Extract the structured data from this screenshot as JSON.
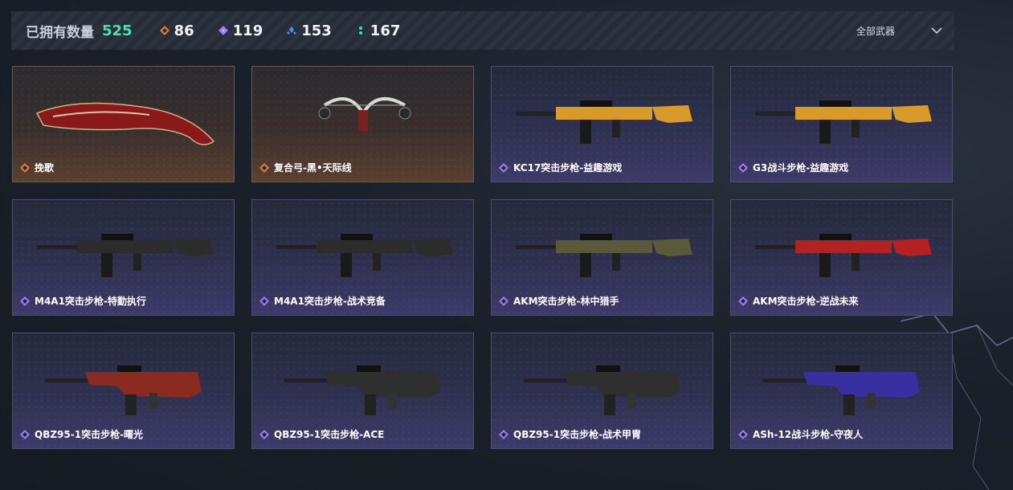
{
  "header": {
    "owned_label": "已拥有数量",
    "owned_total": "525",
    "stats": [
      {
        "icon": "orange-diamond-icon",
        "color": "#e0783a",
        "value": "86"
      },
      {
        "icon": "purple-diamond-icon",
        "color": "#9a7cf2",
        "value": "119"
      },
      {
        "icon": "blue-diamond-icon",
        "color": "#4a8ef0",
        "value": "153"
      },
      {
        "icon": "green-dot-icon",
        "color": "#3fe0b0",
        "value": "167"
      }
    ],
    "filter_label": "全部武器"
  },
  "colors": {
    "accent_green": "#3fe6b0",
    "legendary_orange": "#e0783a",
    "epic_purple": "#9a7cf2"
  },
  "weapons": [
    {
      "name": "挽歌",
      "rarity": "orange",
      "icon": "kukri-icon"
    },
    {
      "name": "复合弓-黑•天际线",
      "rarity": "orange",
      "icon": "compound-bow-icon"
    },
    {
      "name": "KC17突击步枪-益趣游戏",
      "rarity": "purple",
      "icon": "assault-rifle-icon"
    },
    {
      "name": "G3战斗步枪-益趣游戏",
      "rarity": "purple",
      "icon": "battle-rifle-icon"
    },
    {
      "name": "M4A1突击步枪-特勤执行",
      "rarity": "purple",
      "icon": "assault-rifle-icon"
    },
    {
      "name": "M4A1突击步枪-战术竞备",
      "rarity": "purple",
      "icon": "assault-rifle-icon"
    },
    {
      "name": "AKM突击步枪-林中猎手",
      "rarity": "purple",
      "icon": "assault-rifle-icon"
    },
    {
      "name": "AKM突击步枪-逆战未来",
      "rarity": "purple",
      "icon": "assault-rifle-icon"
    },
    {
      "name": "QBZ95-1突击步枪-曙光",
      "rarity": "purple",
      "icon": "bullpup-rifle-icon"
    },
    {
      "name": "QBZ95-1突击步枪-ACE",
      "rarity": "purple",
      "icon": "bullpup-rifle-icon"
    },
    {
      "name": "QBZ95-1突击步枪-战术甲胄",
      "rarity": "purple",
      "icon": "bullpup-rifle-icon"
    },
    {
      "name": "ASh-12战斗步枪-守夜人",
      "rarity": "purple",
      "icon": "bullpup-rifle-icon"
    }
  ]
}
